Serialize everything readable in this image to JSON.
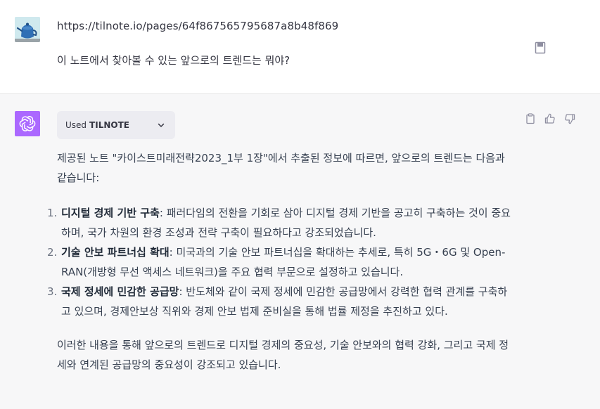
{
  "user": {
    "url": "https://tilnote.io/pages/64f867565795687a8b48f869",
    "question": "이 노트에서 찾아볼 수 있는 앞으로의 트렌드는 뭐야?"
  },
  "assistant": {
    "plugin_used_prefix": "Used",
    "plugin_name": "TILNOTE",
    "intro": "제공된 노트 \"카이스트미래전략2023_1부 1장\"에서 추출된 정보에 따르면, 앞으로의 트렌드는 다음과 같습니다:",
    "items": [
      {
        "num": "1.",
        "title": "디지털 경제 기반 구축",
        "text": ": 패러다임의 전환을 기회로 삼아 디지털 경제 기반을 공고히 구축하는 것이 중요하며, 국가 차원의 환경 조성과 전략 구축이 필요하다고 강조되었습니다."
      },
      {
        "num": "2.",
        "title": "기술 안보 파트너십 확대",
        "text": ": 미국과의 기술 안보 파트너십을 확대하는 추세로, 특히 5G・6G 및 Open-RAN(개방형 무선 액세스 네트워크)을 주요 협력 부문으로 설정하고 있습니다."
      },
      {
        "num": "3.",
        "title": "국제 정세에 민감한 공급망",
        "text": ": 반도체와 같이 국제 정세에 민감한 공급망에서 강력한 협력 관계를 구축하고 있으며, 경제안보상 직위와 경제 안보 법제 준비실을 통해 법률 제정을 추진하고 있다."
      }
    ],
    "closing": "이러한 내용을 통해 앞으로의 트렌드로 디지털 경제의 중요성, 기술 안보와의 협력 강화, 그리고 국제 정세와 연계된 공급망의 중요성이 강조되고 있습니다."
  },
  "icons": {
    "user_avatar": "teapot-avatar-icon",
    "bot_avatar": "openai-logo-icon",
    "edit": "edit-note-icon",
    "chevron": "chevron-down-icon",
    "copy": "clipboard-icon",
    "thumbs_up": "thumbs-up-icon",
    "thumbs_down": "thumbs-down-icon"
  },
  "colors": {
    "bot_avatar_bg": "#ab68ff",
    "assistant_bg": "#f7f7f8",
    "pill_bg": "#ececf1",
    "user_avatar_bg": "#cfe9ee"
  }
}
